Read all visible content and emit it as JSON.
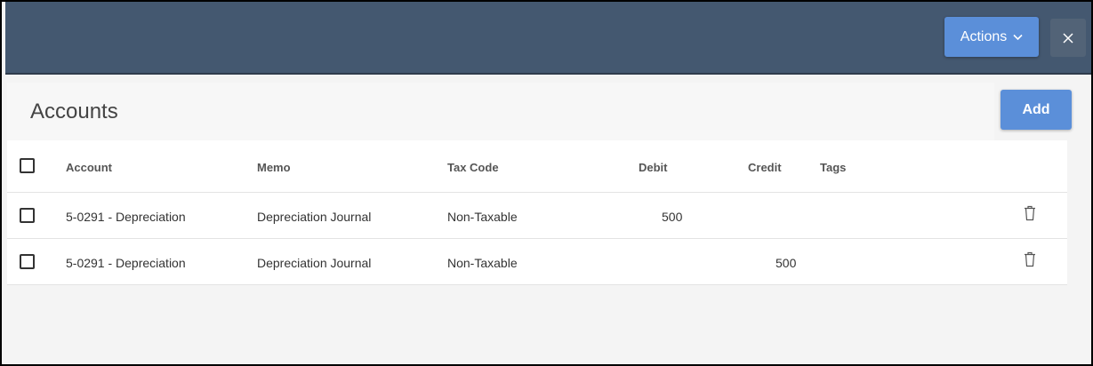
{
  "toolbar": {
    "actions_label": "Actions",
    "close_label": "×"
  },
  "panel": {
    "title": "Accounts",
    "add_label": "Add"
  },
  "table": {
    "columns": {
      "account": "Account",
      "memo": "Memo",
      "tax_code": "Tax Code",
      "debit": "Debit",
      "credit": "Credit",
      "tags": "Tags"
    },
    "rows": [
      {
        "account": "5-0291 - Depreciation",
        "memo": "Depreciation Journal",
        "tax_code": "Non-Taxable",
        "debit": "500",
        "credit": "",
        "tags": ""
      },
      {
        "account": "5-0291 - Depreciation",
        "memo": "Depreciation Journal",
        "tax_code": "Non-Taxable",
        "debit": "",
        "credit": "500",
        "tags": ""
      }
    ]
  },
  "icons": {
    "actions": "chevron-down-icon",
    "close": "close-icon",
    "row_delete": "trash-icon"
  },
  "colors": {
    "topbar": "#445870",
    "primary_button": "#5b8fd9",
    "close_button": "#526377"
  }
}
